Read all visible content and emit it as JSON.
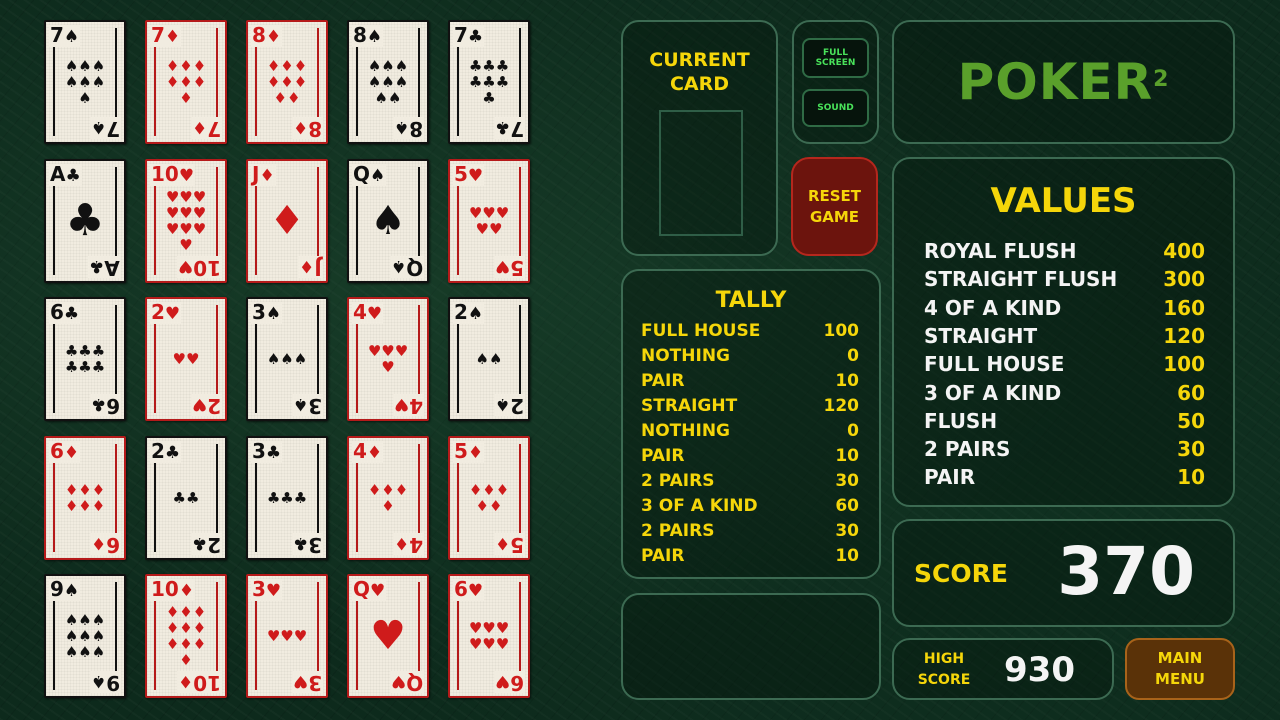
{
  "cards": [
    {
      "rank": "7",
      "suit": "♠",
      "color": "black",
      "pips": "♠♠♠♠♠♠♠"
    },
    {
      "rank": "7",
      "suit": "♦",
      "color": "red",
      "pips": "♦♦♦♦♦♦♦"
    },
    {
      "rank": "8",
      "suit": "♦",
      "color": "red",
      "pips": "♦♦♦♦♦♦♦♦"
    },
    {
      "rank": "8",
      "suit": "♠",
      "color": "black",
      "pips": "♠♠♠♠♠♠♠♠"
    },
    {
      "rank": "7",
      "suit": "♣",
      "color": "black",
      "pips": "♣♣♣♣♣♣♣"
    },
    {
      "rank": "A",
      "suit": "♣",
      "color": "black",
      "pips": "♣",
      "big": true
    },
    {
      "rank": "10",
      "suit": "♥",
      "color": "red",
      "pips": "♥♥♥♥♥♥♥♥♥♥"
    },
    {
      "rank": "J",
      "suit": "♦",
      "color": "red",
      "pips": "♦",
      "face": true
    },
    {
      "rank": "Q",
      "suit": "♠",
      "color": "black",
      "pips": "♠",
      "face": true
    },
    {
      "rank": "5",
      "suit": "♥",
      "color": "red",
      "pips": "♥♥♥♥♥"
    },
    {
      "rank": "6",
      "suit": "♣",
      "color": "black",
      "pips": "♣♣♣♣♣♣"
    },
    {
      "rank": "2",
      "suit": "♥",
      "color": "red",
      "pips": "♥♥"
    },
    {
      "rank": "3",
      "suit": "♠",
      "color": "black",
      "pips": "♠♠♠"
    },
    {
      "rank": "4",
      "suit": "♥",
      "color": "red",
      "pips": "♥♥♥♥"
    },
    {
      "rank": "2",
      "suit": "♠",
      "color": "black",
      "pips": "♠♠"
    },
    {
      "rank": "6",
      "suit": "♦",
      "color": "red",
      "pips": "♦♦♦♦♦♦"
    },
    {
      "rank": "2",
      "suit": "♣",
      "color": "black",
      "pips": "♣♣"
    },
    {
      "rank": "3",
      "suit": "♣",
      "color": "black",
      "pips": "♣♣♣"
    },
    {
      "rank": "4",
      "suit": "♦",
      "color": "red",
      "pips": "♦♦♦♦"
    },
    {
      "rank": "5",
      "suit": "♦",
      "color": "red",
      "pips": "♦♦♦♦♦"
    },
    {
      "rank": "9",
      "suit": "♠",
      "color": "black",
      "pips": "♠♠♠♠♠♠♠♠♠"
    },
    {
      "rank": "10",
      "suit": "♦",
      "color": "red",
      "pips": "♦♦♦♦♦♦♦♦♦♦"
    },
    {
      "rank": "3",
      "suit": "♥",
      "color": "red",
      "pips": "♥♥♥"
    },
    {
      "rank": "Q",
      "suit": "♥",
      "color": "red",
      "pips": "♥",
      "face": true
    },
    {
      "rank": "6",
      "suit": "♥",
      "color": "red",
      "pips": "♥♥♥♥♥♥"
    }
  ],
  "current_card": {
    "title": "CURRENT\nCARD"
  },
  "buttons": {
    "fullscreen": "FULL\nSCREEN",
    "sound": "SOUND",
    "reset": "RESET\nGAME",
    "main_menu": "MAIN\nMENU"
  },
  "logo": {
    "text": "POKER",
    "sup": "2"
  },
  "values": {
    "title": "VALUES",
    "items": [
      {
        "label": "ROYAL FLUSH",
        "value": "400"
      },
      {
        "label": "STRAIGHT FLUSH",
        "value": "300"
      },
      {
        "label": "4 OF A KIND",
        "value": "160"
      },
      {
        "label": "STRAIGHT",
        "value": "120"
      },
      {
        "label": "FULL HOUSE",
        "value": "100"
      },
      {
        "label": "3 OF A KIND",
        "value": "60"
      },
      {
        "label": "FLUSH",
        "value": "50"
      },
      {
        "label": "2 PAIRS",
        "value": "30"
      },
      {
        "label": "PAIR",
        "value": "10"
      }
    ]
  },
  "tally": {
    "title": "TALLY",
    "items": [
      {
        "label": "FULL HOUSE",
        "value": "100"
      },
      {
        "label": "NOTHING",
        "value": "0"
      },
      {
        "label": "PAIR",
        "value": "10"
      },
      {
        "label": "STRAIGHT",
        "value": "120"
      },
      {
        "label": "NOTHING",
        "value": "0"
      },
      {
        "label": "PAIR",
        "value": "10"
      },
      {
        "label": "2 PAIRS",
        "value": "30"
      },
      {
        "label": "3 OF A KIND",
        "value": "60"
      },
      {
        "label": "2 PAIRS",
        "value": "30"
      },
      {
        "label": "PAIR",
        "value": "10"
      }
    ]
  },
  "score": {
    "label": "SCORE",
    "value": "370"
  },
  "high_score": {
    "label": "HIGH\nSCORE",
    "value": "930"
  }
}
